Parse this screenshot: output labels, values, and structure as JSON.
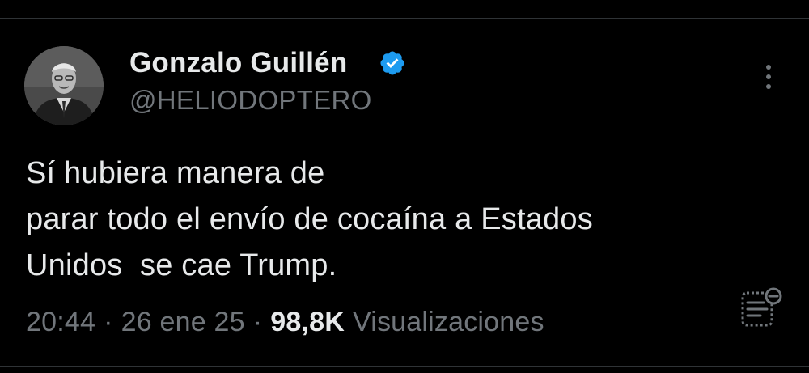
{
  "tweet": {
    "author": {
      "name": "Gonzalo Guillén",
      "handle": "@HELIODOPTERO",
      "verified": true,
      "avatar": "avatar-photo-grayscale"
    },
    "text_lines": [
      "Sí hubiera manera de",
      "parar todo el envío de cocaína a Estados",
      "Unidos  se cae Trump."
    ],
    "meta": {
      "time": "20:44",
      "separator": "·",
      "date": "26 ene 25",
      "views_count": "98,8K",
      "views_label": "Visualizaciones"
    }
  },
  "icons": {
    "verified": "verified-badge-icon",
    "more": "more-vertical-icon",
    "analytics": "post-analytics-icon"
  },
  "colors": {
    "background": "#000000",
    "primary_text": "#e7e9ea",
    "secondary_text": "#71767b",
    "verified_blue": "#1d9bf0",
    "divider": "#2f3336"
  }
}
